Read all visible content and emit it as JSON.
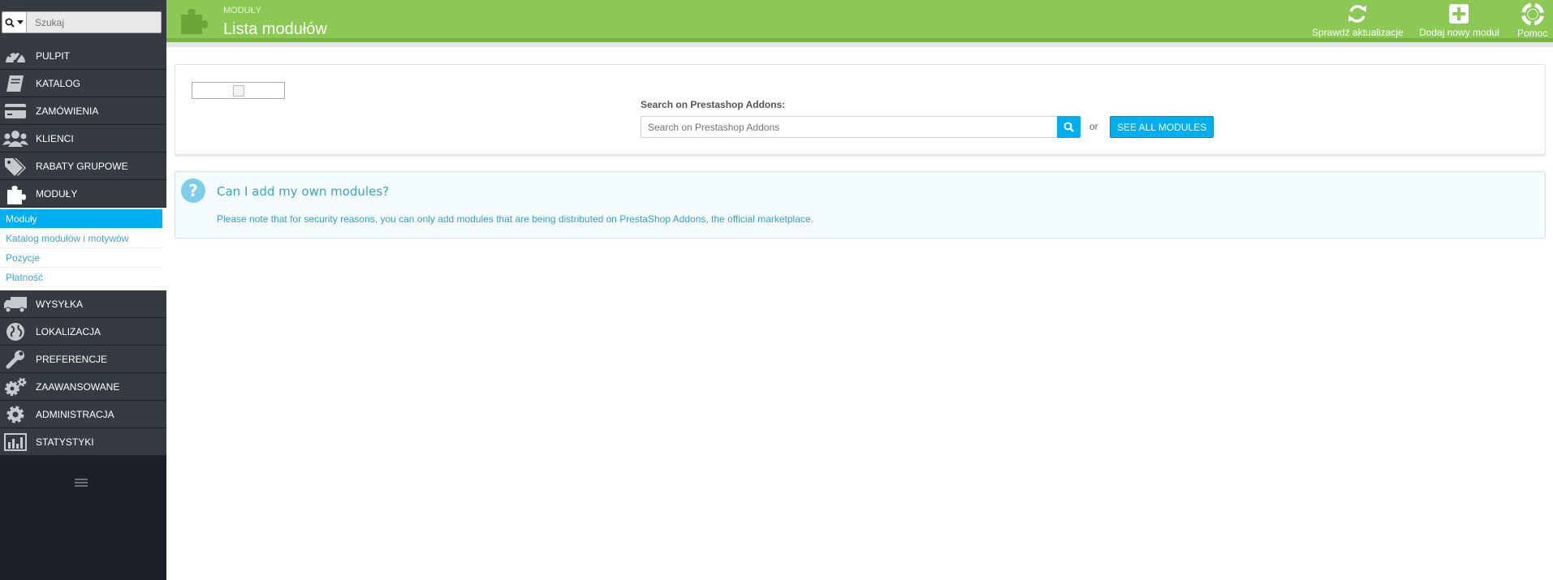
{
  "search": {
    "placeholder": "Szukaj"
  },
  "sidebar": {
    "items": [
      {
        "label": "PULPIT",
        "icon": "dashboard-gauge-icon"
      },
      {
        "label": "KATALOG",
        "icon": "book-icon"
      },
      {
        "label": "ZAMÓWIENIA",
        "icon": "credit-card-icon"
      },
      {
        "label": "KLIENCI",
        "icon": "users-icon"
      },
      {
        "label": "RABATY GRUPOWE",
        "icon": "tags-icon"
      },
      {
        "label": "MODUŁY",
        "icon": "puzzle-icon"
      },
      {
        "label": "WYSYŁKA",
        "icon": "truck-icon"
      },
      {
        "label": "LOKALIZACJA",
        "icon": "globe-icon"
      },
      {
        "label": "PREFERENCJE",
        "icon": "wrench-icon"
      },
      {
        "label": "ZAAWANSOWANE",
        "icon": "cogs-icon"
      },
      {
        "label": "ADMINISTRACJA",
        "icon": "cog-icon"
      },
      {
        "label": "STATYSTYKI",
        "icon": "bar-chart-icon"
      }
    ],
    "submenu": [
      {
        "label": "Moduły",
        "active": true
      },
      {
        "label": "Katalog modułów i motywów"
      },
      {
        "label": "Pozycje"
      },
      {
        "label": "Płatność"
      }
    ]
  },
  "header": {
    "breadcrumb": "MODUŁY",
    "title": "Lista modułów",
    "buttons": [
      {
        "label": "Sprawdź aktualizacje",
        "icon": "refresh-icon"
      },
      {
        "label": "Dodaj nowy moduł",
        "icon": "plus-square-icon"
      },
      {
        "label": "Pomoc",
        "icon": "lifebuoy-icon"
      }
    ]
  },
  "addons": {
    "label": "Search on Prestashop Addons:",
    "placeholder": "Search on Prestashop Addons",
    "or": "or",
    "see_all": "SEE ALL MODULES"
  },
  "info": {
    "title": "Can I add my own modules?",
    "text": "Please note that for security reasons, you can only add modules that are being distributed on PrestaShop Addons, the official marketplace."
  },
  "colors": {
    "header_green": "#8bc954",
    "accent_blue": "#00aff0",
    "sidebar_dark": "#363a41"
  }
}
